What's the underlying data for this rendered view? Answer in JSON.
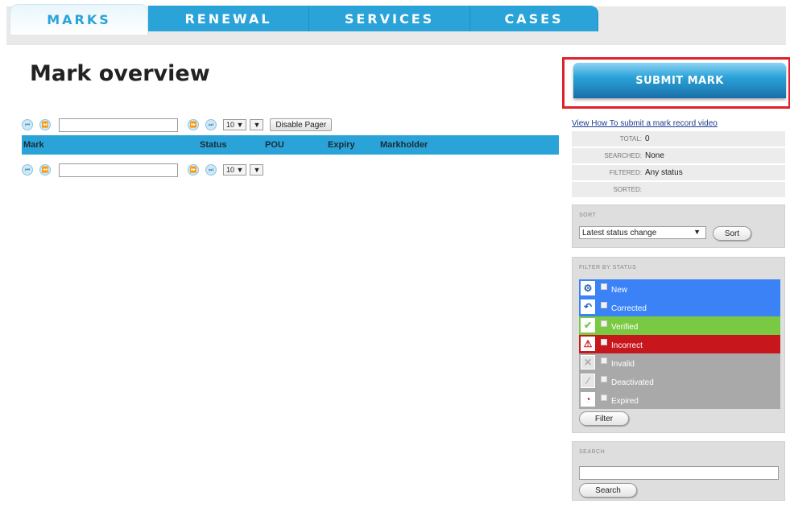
{
  "tabs": [
    {
      "label": "MARKS",
      "active": true
    },
    {
      "label": "RENEWAL",
      "active": false
    },
    {
      "label": "SERVICES",
      "active": false
    },
    {
      "label": "CASES",
      "active": false
    }
  ],
  "page_title": "Mark overview",
  "pager": {
    "page_size": "10",
    "disable_label": "Disable Pager"
  },
  "table": {
    "columns": [
      "Mark",
      "Status",
      "POU",
      "Expiry",
      "Markholder"
    ]
  },
  "submit_label": "SUBMIT MARK",
  "video_link": "View How To submit a mark record video",
  "stats": [
    {
      "key": "TOTAL:",
      "value": "0"
    },
    {
      "key": "SEARCHED:",
      "value": "None"
    },
    {
      "key": "FILTERED:",
      "value": "Any status"
    },
    {
      "key": "SORTED:",
      "value": ""
    }
  ],
  "sort": {
    "heading": "SORT",
    "selected": "Latest status change",
    "button": "Sort"
  },
  "filter": {
    "heading": "FILTER BY STATUS",
    "button": "Filter",
    "statuses": [
      {
        "label": "New",
        "icon": "gear-icon",
        "color": "#3b82f6"
      },
      {
        "label": "Corrected",
        "icon": "undo-icon",
        "color": "#3b82f6"
      },
      {
        "label": "Verified",
        "icon": "check-icon",
        "color": "#7ac943"
      },
      {
        "label": "Incorrect",
        "icon": "warning-icon",
        "color": "#c8161d"
      },
      {
        "label": "Invalid",
        "icon": "x-icon",
        "color": "#a9a9a9"
      },
      {
        "label": "Deactivated",
        "icon": "slash-icon",
        "color": "#a9a9a9"
      },
      {
        "label": "Expired",
        "icon": "clock-icon",
        "color": "#a9a9a9"
      }
    ]
  },
  "search": {
    "heading": "SEARCH",
    "button": "Search"
  }
}
